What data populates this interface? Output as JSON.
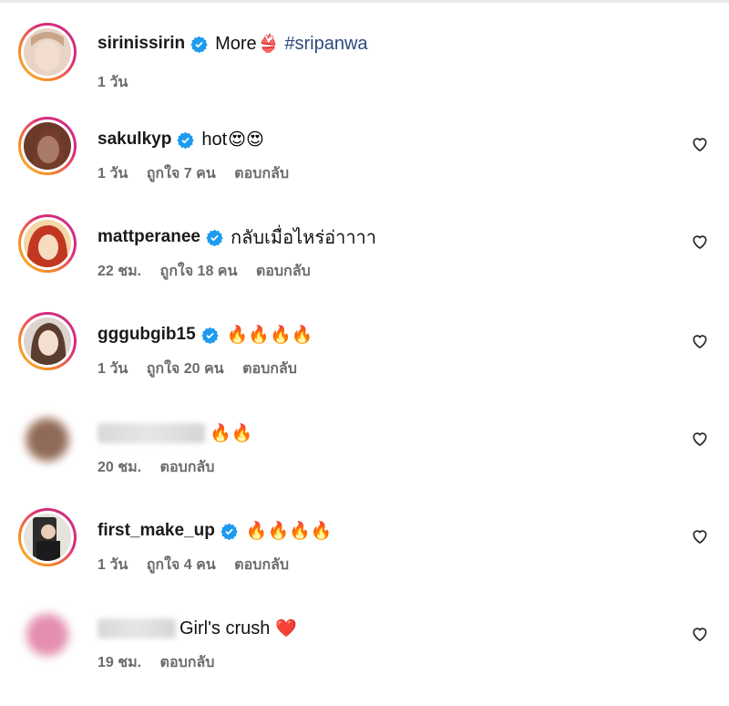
{
  "comments": [
    {
      "username": "sirinissirin",
      "verified": true,
      "text": "More",
      "emoji": "👙",
      "hashtag": "#sripanwa",
      "time": "1 วัน",
      "likes": "",
      "reply": "",
      "has_heart": false
    },
    {
      "username": "sakulkyp",
      "verified": true,
      "text": "hot",
      "emoji": "😍😍",
      "time": "1 วัน",
      "likes": "ถูกใจ 7 คน",
      "reply": "ตอบกลับ",
      "has_heart": true
    },
    {
      "username": "mattperanee",
      "verified": true,
      "text": "กลับเมื่อไหร่อ่าาาา",
      "emoji": "",
      "time": "22 ชม.",
      "likes": "ถูกใจ 18 คน",
      "reply": "ตอบกลับ",
      "has_heart": true
    },
    {
      "username": "gggubgib15",
      "verified": true,
      "text": "",
      "emoji": "🔥🔥🔥🔥",
      "time": "1 วัน",
      "likes": "ถูกใจ 20 คน",
      "reply": "ตอบกลับ",
      "has_heart": true
    },
    {
      "username": "",
      "verified": false,
      "text": "",
      "emoji": "🔥🔥",
      "time": "20 ชม.",
      "likes": "",
      "reply": "ตอบกลับ",
      "has_heart": true
    },
    {
      "username": "first_make_up",
      "verified": true,
      "text": "",
      "emoji": "🔥🔥🔥🔥",
      "time": "1 วัน",
      "likes": "ถูกใจ 4 คน",
      "reply": "ตอบกลับ",
      "has_heart": true
    },
    {
      "username": "",
      "verified": false,
      "text": "Girl's crush",
      "emoji": "❤️",
      "time": "19 ชม.",
      "likes": "",
      "reply": "ตอบกลับ",
      "has_heart": true
    }
  ],
  "colors": {
    "verified": "#1d9bf0",
    "hashtag": "#2a4a7d",
    "meta": "#6b6b6b"
  },
  "icons": {
    "verified": "verified-badge-icon",
    "like": "heart-outline-icon"
  }
}
